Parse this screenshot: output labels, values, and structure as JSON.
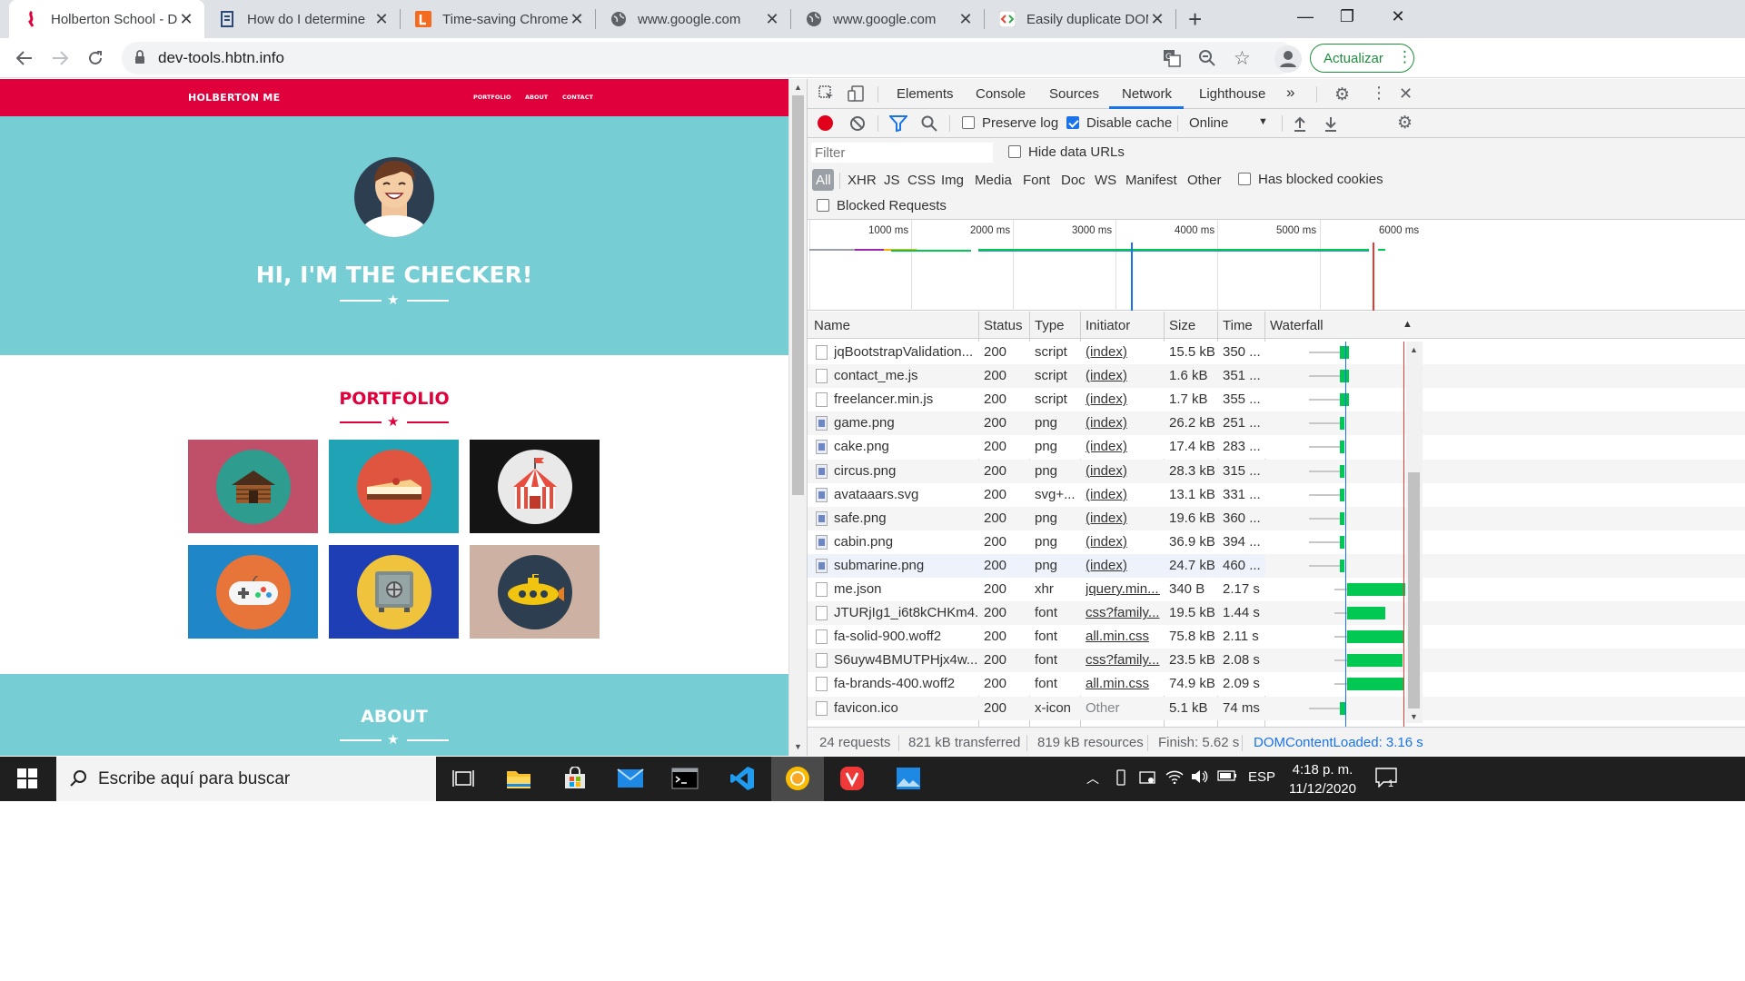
{
  "browser": {
    "tabs": [
      {
        "title": "Holberton School - D",
        "active": true
      },
      {
        "title": "How do I determine",
        "active": false
      },
      {
        "title": "Time-saving Chrome",
        "active": false
      },
      {
        "title": "www.google.com",
        "active": false
      },
      {
        "title": "www.google.com",
        "active": false
      },
      {
        "title": "Easily duplicate DOM",
        "active": false
      }
    ],
    "new_tab_glyph": "+",
    "url": "dev-tools.hbtn.info",
    "update_button": "Actualizar",
    "more_glyph": "⋮"
  },
  "site": {
    "brand": "HOLBERTON ME",
    "nav": [
      "PORTFOLIO",
      "ABOUT",
      "CONTACT"
    ],
    "hero_title": "HI, I'M THE CHECKER!",
    "portfolio_title": "PORTFOLIO",
    "about_title": "ABOUT",
    "tiles": [
      {
        "name": "cabin",
        "bg": "#c0506a",
        "circle": "#2e9c8e"
      },
      {
        "name": "cake",
        "bg": "#1fa3b5",
        "circle": "#e0553f"
      },
      {
        "name": "circus",
        "bg": "#141414",
        "circle": "#e9e9e9"
      },
      {
        "name": "game",
        "bg": "#1f86c7",
        "circle": "#e7753a"
      },
      {
        "name": "safe",
        "bg": "#1d3eb4",
        "circle": "#f0c33c"
      },
      {
        "name": "submarine",
        "bg": "#cdb2a3",
        "circle": "#2c3e50"
      }
    ]
  },
  "devtools": {
    "tabs": [
      "Elements",
      "Console",
      "Sources",
      "Network",
      "Lighthouse"
    ],
    "selected_tab": "Network",
    "more_tabs": "»",
    "toolbar": {
      "preserve_log": "Preserve log",
      "disable_cache": "Disable cache",
      "throttle": "Online"
    },
    "filter": {
      "placeholder": "Filter",
      "hide_data_urls": "Hide data URLs",
      "types": [
        "All",
        "XHR",
        "JS",
        "CSS",
        "Img",
        "Media",
        "Font",
        "Doc",
        "WS",
        "Manifest",
        "Other"
      ],
      "has_blocked_cookies": "Has blocked cookies",
      "blocked_requests": "Blocked Requests"
    },
    "timeline_ticks": [
      "1000 ms",
      "2000 ms",
      "3000 ms",
      "4000 ms",
      "5000 ms",
      "6000 ms"
    ],
    "columns": [
      "Name",
      "Status",
      "Type",
      "Initiator",
      "Size",
      "Time",
      "Waterfall"
    ],
    "requests": [
      {
        "name": "jqBootstrapValidation...",
        "status": "200",
        "type": "script",
        "initiator": "(index)",
        "size": "15.5 kB",
        "time": "350 ...",
        "icon": "doc"
      },
      {
        "name": "contact_me.js",
        "status": "200",
        "type": "script",
        "initiator": "(index)",
        "size": "1.6 kB",
        "time": "351 ...",
        "icon": "doc"
      },
      {
        "name": "freelancer.min.js",
        "status": "200",
        "type": "script",
        "initiator": "(index)",
        "size": "1.7 kB",
        "time": "355 ...",
        "icon": "doc"
      },
      {
        "name": "game.png",
        "status": "200",
        "type": "png",
        "initiator": "(index)",
        "size": "26.2 kB",
        "time": "251 ...",
        "icon": "img"
      },
      {
        "name": "cake.png",
        "status": "200",
        "type": "png",
        "initiator": "(index)",
        "size": "17.4 kB",
        "time": "283 ...",
        "icon": "img"
      },
      {
        "name": "circus.png",
        "status": "200",
        "type": "png",
        "initiator": "(index)",
        "size": "28.3 kB",
        "time": "315 ...",
        "icon": "img"
      },
      {
        "name": "avataaars.svg",
        "status": "200",
        "type": "svg+...",
        "initiator": "(index)",
        "size": "13.1 kB",
        "time": "331 ...",
        "icon": "img"
      },
      {
        "name": "safe.png",
        "status": "200",
        "type": "png",
        "initiator": "(index)",
        "size": "19.6 kB",
        "time": "360 ...",
        "icon": "img"
      },
      {
        "name": "cabin.png",
        "status": "200",
        "type": "png",
        "initiator": "(index)",
        "size": "36.9 kB",
        "time": "394 ...",
        "icon": "img"
      },
      {
        "name": "submarine.png",
        "status": "200",
        "type": "png",
        "initiator": "(index)",
        "size": "24.7 kB",
        "time": "460 ...",
        "icon": "img"
      },
      {
        "name": "me.json",
        "status": "200",
        "type": "xhr",
        "initiator": "jquery.min....",
        "size": "340 B",
        "time": "2.17 s",
        "icon": "doc"
      },
      {
        "name": "JTURjIg1_i6t8kCHKm4...",
        "status": "200",
        "type": "font",
        "initiator": "css?family...",
        "size": "19.5 kB",
        "time": "1.44 s",
        "icon": "doc"
      },
      {
        "name": "fa-solid-900.woff2",
        "status": "200",
        "type": "font",
        "initiator": "all.min.css",
        "size": "75.8 kB",
        "time": "2.11 s",
        "icon": "doc"
      },
      {
        "name": "S6uyw4BMUTPHjx4w...",
        "status": "200",
        "type": "font",
        "initiator": "css?family...",
        "size": "23.5 kB",
        "time": "2.08 s",
        "icon": "doc"
      },
      {
        "name": "fa-brands-400.woff2",
        "status": "200",
        "type": "font",
        "initiator": "all.min.css",
        "size": "74.9 kB",
        "time": "2.09 s",
        "icon": "doc"
      },
      {
        "name": "favicon.ico",
        "status": "200",
        "type": "x-icon",
        "initiator": "Other",
        "size": "5.1 kB",
        "time": "74 ms",
        "icon": "doc"
      }
    ],
    "status_bar": {
      "requests": "24 requests",
      "transferred": "821 kB transferred",
      "resources": "819 kB resources",
      "finish": "Finish: 5.62 s",
      "dcl": "DOMContentLoaded: 3.16 s"
    }
  },
  "taskbar": {
    "search_placeholder": "Escribe aquí para buscar",
    "language": "ESP",
    "time": "4:18 p. m.",
    "date": "11/12/2020",
    "notifications": "1"
  }
}
